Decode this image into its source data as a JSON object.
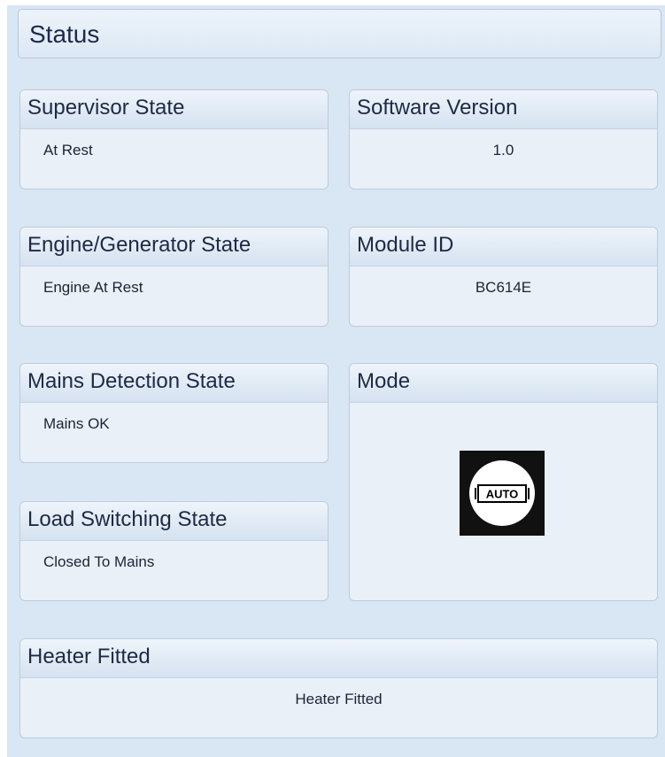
{
  "status_title": "Status",
  "panels": {
    "supervisor_state": {
      "title": "Supervisor State",
      "value": "At Rest"
    },
    "software_version": {
      "title": "Software Version",
      "value": "1.0"
    },
    "engine_generator_state": {
      "title": "Engine/Generator State",
      "value": "Engine At Rest"
    },
    "module_id": {
      "title": "Module ID",
      "value": "BC614E"
    },
    "mains_detection_state": {
      "title": "Mains Detection State",
      "value": "Mains OK"
    },
    "mode": {
      "title": "Mode",
      "icon": "auto-mode-icon",
      "icon_text": "AUTO"
    },
    "load_switching_state": {
      "title": "Load Switching State",
      "value": "Closed To Mains"
    },
    "heater_fitted": {
      "title": "Heater Fitted",
      "value": "Heater Fitted"
    }
  }
}
